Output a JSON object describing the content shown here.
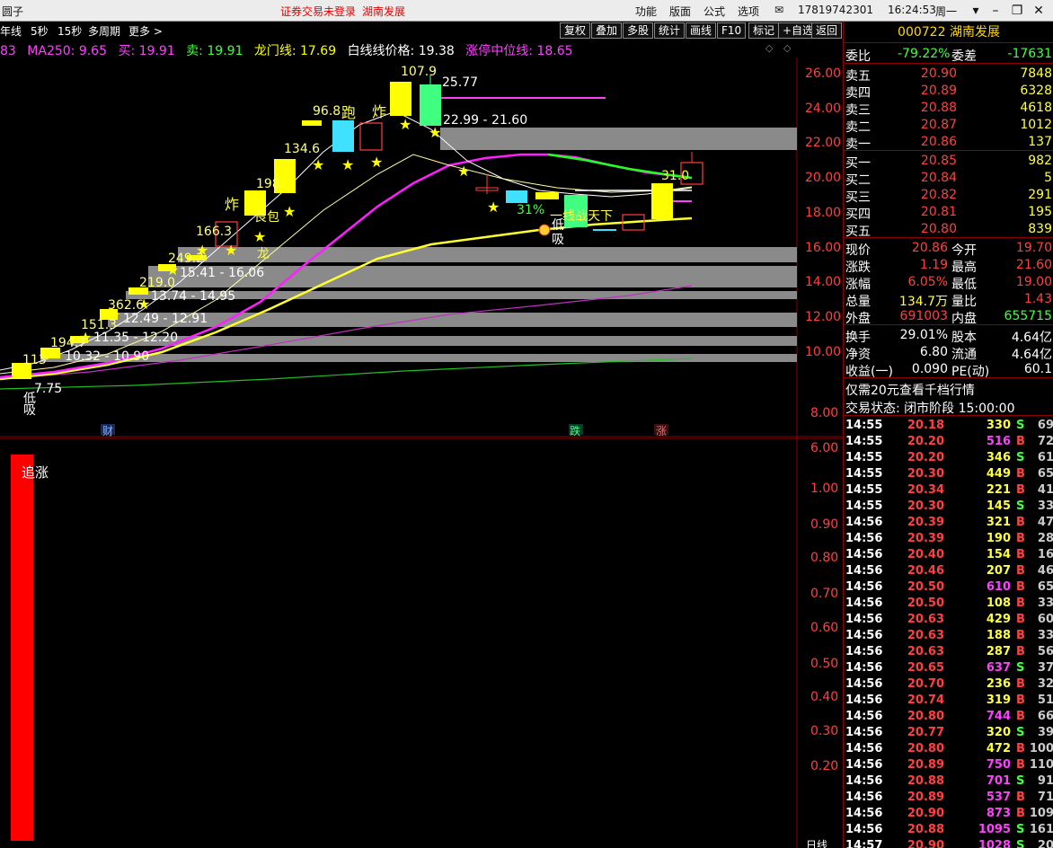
{
  "app": {
    "left_title": "圆子",
    "notice": "证券交易未登录",
    "stock_name_top": "湖南发展",
    "menus": [
      "功能",
      "版面",
      "公式",
      "选项"
    ],
    "phone": "17819742301",
    "time": "16:24:53",
    "weekday": "周一"
  },
  "toolbar": {
    "periods": [
      "年线",
      "5秒",
      "15秒",
      "多周期",
      "更多 >"
    ],
    "buttons": [
      "复权",
      "叠加",
      "多股",
      "统计",
      "画线",
      "F10",
      "标记",
      "+自选",
      "返回"
    ]
  },
  "legend": [
    {
      "text": "83",
      "color": "#ff40ff"
    },
    {
      "text": "MA250: 9.65",
      "color": "#ff40ff"
    },
    {
      "text": "买: 19.91",
      "color": "#ff40ff"
    },
    {
      "text": "卖: 19.91",
      "color": "#40ff40"
    },
    {
      "text": "龙门线: 17.69",
      "color": "#ffff00"
    },
    {
      "text": "白线线价格: 19.38",
      "color": "#ffffff"
    },
    {
      "text": "涨停中位线: 18.65",
      "color": "#ff40ff"
    }
  ],
  "price_axis": [
    "26.00",
    "24.00",
    "22.00",
    "20.00",
    "18.00",
    "16.00",
    "14.00",
    "12.00",
    "10.00",
    "8.00",
    "6.00"
  ],
  "indicator_axis": [
    "1.00",
    "0.90",
    "0.80",
    "0.70",
    "0.60",
    "0.50",
    "0.40",
    "0.30",
    "0.20"
  ],
  "chart_labels": {
    "high_peak": "107.9",
    "level_1": "25.77",
    "zone_1": "22.99 - 21.60",
    "zone_2": "15.41 - 16.06",
    "zone_3": "13.74 - 14.95",
    "zone_4": "12.49 - 12.91",
    "zone_5": "11.35 - 12.20",
    "zone_6": "10.32 - 10.90",
    "low": "7.75",
    "pct": "31%",
    "line_text": "一线战天下",
    "right_val": "31.0",
    "v968": "96.8",
    "v1346": "134.6",
    "v198": "198",
    "v1663": "166.3",
    "v2492": "249.2",
    "v2190": "219.0",
    "v3626": "362.6",
    "v1513": "151.3",
    "v1947": "194.7",
    "v113": "113",
    "w_pao": "跑",
    "w_zha1": "炸",
    "w_zha2": "炸",
    "w_bao": "良包",
    "w_long": "龙",
    "w_di": "低",
    "w_xi": "吸",
    "w_di2": "低",
    "w_xi2": "吸",
    "w_cai": "财",
    "w_die": "跌",
    "w_zhang": "涨",
    "w_zhuizhang": "追涨"
  },
  "quote": {
    "code": "000722",
    "name": "湖南发展",
    "wei_bi_label": "委比",
    "wei_bi": "-79.22%",
    "wei_cha_label": "委差",
    "wei_cha": "-17631",
    "asks": [
      {
        "label": "卖五",
        "price": "20.90",
        "vol": "7848"
      },
      {
        "label": "卖四",
        "price": "20.89",
        "vol": "6328"
      },
      {
        "label": "卖三",
        "price": "20.88",
        "vol": "4618"
      },
      {
        "label": "卖二",
        "price": "20.87",
        "vol": "1012"
      },
      {
        "label": "卖一",
        "price": "20.86",
        "vol": "137"
      }
    ],
    "bids": [
      {
        "label": "买一",
        "price": "20.85",
        "vol": "982"
      },
      {
        "label": "买二",
        "price": "20.84",
        "vol": "5"
      },
      {
        "label": "买三",
        "price": "20.82",
        "vol": "291"
      },
      {
        "label": "买四",
        "price": "20.81",
        "vol": "195"
      },
      {
        "label": "买五",
        "price": "20.80",
        "vol": "839"
      }
    ],
    "stats": [
      {
        "l1": "现价",
        "v1": "20.86",
        "c1": "#ff4040",
        "l2": "今开",
        "v2": "19.70",
        "c2": "#ff4040"
      },
      {
        "l1": "涨跌",
        "v1": "1.19",
        "c1": "#ff4040",
        "l2": "最高",
        "v2": "21.60",
        "c2": "#ff4040"
      },
      {
        "l1": "涨幅",
        "v1": "6.05%",
        "c1": "#ff4040",
        "l2": "最低",
        "v2": "19.00",
        "c2": "#ff4040"
      },
      {
        "l1": "总量",
        "v1": "134.7万",
        "c1": "#ffff40",
        "l2": "量比",
        "v2": "1.43",
        "c2": "#ff4040"
      },
      {
        "l1": "外盘",
        "v1": "691003",
        "c1": "#ff4040",
        "l2": "内盘",
        "v2": "655715",
        "c2": "#40ff40"
      }
    ],
    "stats2": [
      {
        "l1": "换手",
        "v1": "29.01%",
        "l2": "股本",
        "v2": "4.64亿"
      },
      {
        "l1": "净资",
        "v1": "6.80",
        "l2": "流通",
        "v2": "4.64亿"
      },
      {
        "l1": "收益(一)",
        "v1": "0.090",
        "l2": "PE(动)",
        "v2": "60.1"
      }
    ],
    "promo": "仅需20元查看千档行情",
    "status": "交易状态: 闭市阶段 15:00:00"
  },
  "ticks": [
    {
      "t": "14:55",
      "p": "20.18",
      "v": "330",
      "s": "S",
      "n": "69"
    },
    {
      "t": "14:55",
      "p": "20.20",
      "v": "516",
      "s": "B",
      "n": "72"
    },
    {
      "t": "14:55",
      "p": "20.20",
      "v": "346",
      "s": "S",
      "n": "61"
    },
    {
      "t": "14:55",
      "p": "20.30",
      "v": "449",
      "s": "B",
      "n": "65"
    },
    {
      "t": "14:55",
      "p": "20.34",
      "v": "221",
      "s": "B",
      "n": "41"
    },
    {
      "t": "14:55",
      "p": "20.30",
      "v": "145",
      "s": "S",
      "n": "33"
    },
    {
      "t": "14:56",
      "p": "20.39",
      "v": "321",
      "s": "B",
      "n": "47"
    },
    {
      "t": "14:56",
      "p": "20.39",
      "v": "190",
      "s": "B",
      "n": "28"
    },
    {
      "t": "14:56",
      "p": "20.40",
      "v": "154",
      "s": "B",
      "n": "16"
    },
    {
      "t": "14:56",
      "p": "20.46",
      "v": "207",
      "s": "B",
      "n": "46"
    },
    {
      "t": "14:56",
      "p": "20.50",
      "v": "610",
      "s": "B",
      "n": "65"
    },
    {
      "t": "14:56",
      "p": "20.50",
      "v": "108",
      "s": "B",
      "n": "33"
    },
    {
      "t": "14:56",
      "p": "20.63",
      "v": "429",
      "s": "B",
      "n": "60"
    },
    {
      "t": "14:56",
      "p": "20.63",
      "v": "188",
      "s": "B",
      "n": "33"
    },
    {
      "t": "14:56",
      "p": "20.63",
      "v": "287",
      "s": "B",
      "n": "56"
    },
    {
      "t": "14:56",
      "p": "20.65",
      "v": "637",
      "s": "S",
      "n": "37"
    },
    {
      "t": "14:56",
      "p": "20.70",
      "v": "236",
      "s": "B",
      "n": "32"
    },
    {
      "t": "14:56",
      "p": "20.74",
      "v": "319",
      "s": "B",
      "n": "51"
    },
    {
      "t": "14:56",
      "p": "20.80",
      "v": "744",
      "s": "B",
      "n": "66"
    },
    {
      "t": "14:56",
      "p": "20.77",
      "v": "320",
      "s": "S",
      "n": "39"
    },
    {
      "t": "14:56",
      "p": "20.80",
      "v": "472",
      "s": "B",
      "n": "100"
    },
    {
      "t": "14:56",
      "p": "20.89",
      "v": "750",
      "s": "B",
      "n": "110"
    },
    {
      "t": "14:56",
      "p": "20.88",
      "v": "701",
      "s": "S",
      "n": "91"
    },
    {
      "t": "14:56",
      "p": "20.89",
      "v": "537",
      "s": "B",
      "n": "71"
    },
    {
      "t": "14:56",
      "p": "20.90",
      "v": "873",
      "s": "B",
      "n": "109"
    },
    {
      "t": "14:56",
      "p": "20.88",
      "v": "1095",
      "s": "S",
      "n": "161"
    },
    {
      "t": "14:57",
      "p": "20.90",
      "v": "1028",
      "s": "S",
      "n": "20"
    }
  ],
  "footer_label": "日线",
  "colors": {
    "up": "#ff4040",
    "down": "#40ff40",
    "gold": "#ffff00",
    "magenta": "#ff40ff",
    "cyan": "#40e0ff"
  }
}
